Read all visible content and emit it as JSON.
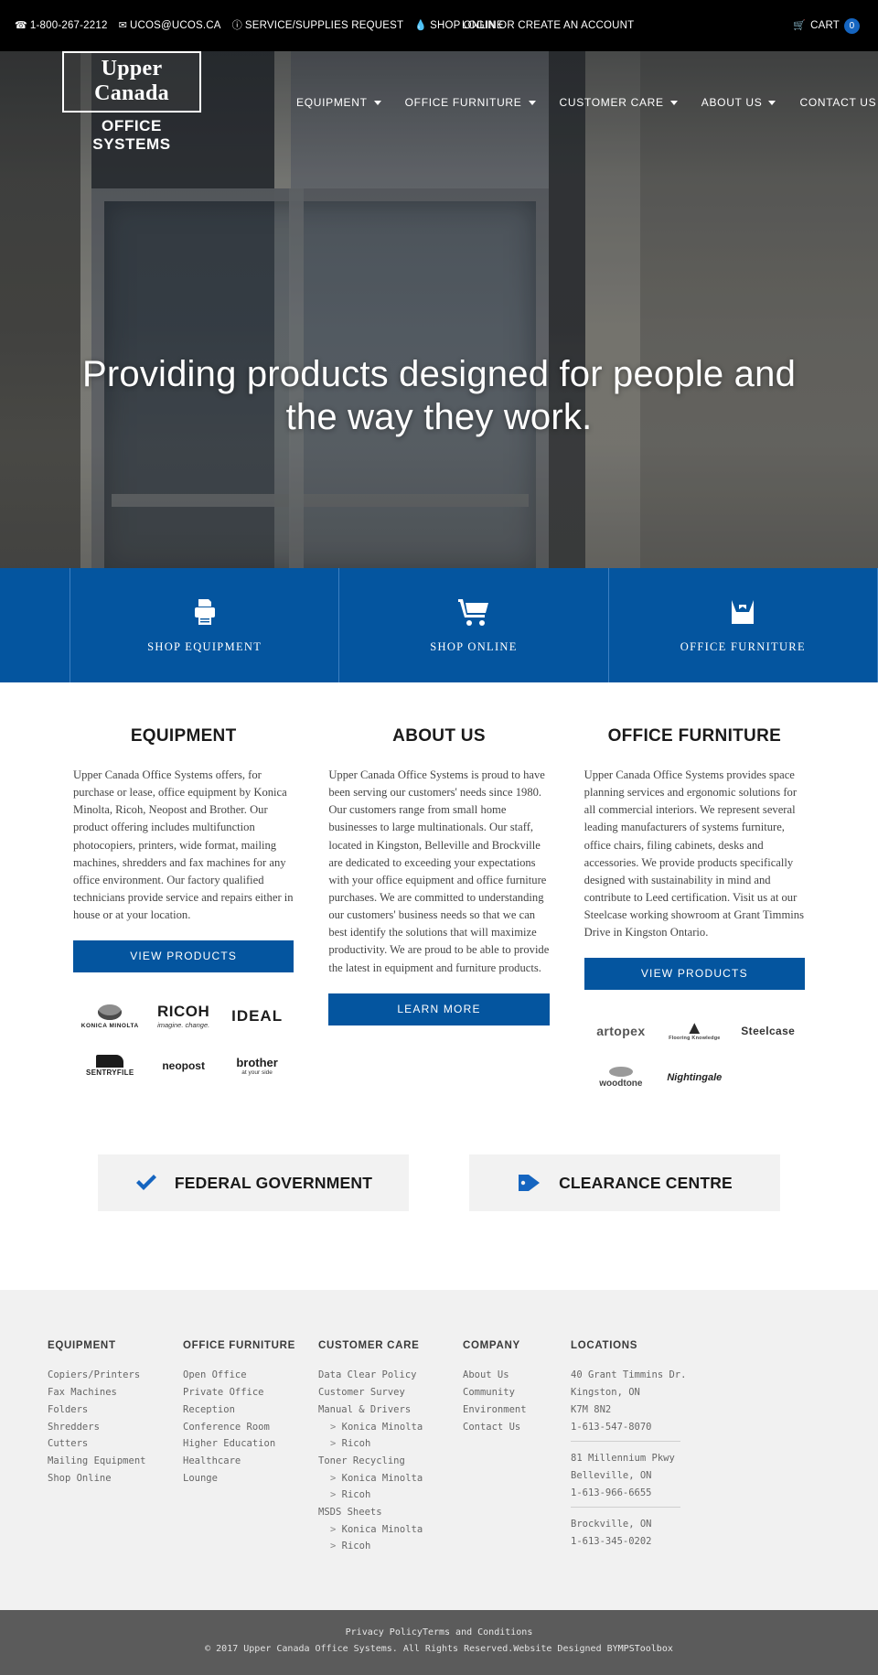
{
  "topbar": {
    "phone": "1-800-267-2212",
    "email": "UCOS@UCOS.CA",
    "service_request": "SERVICE/SUPPLIES REQUEST",
    "shop_online": "SHOP ONLINE",
    "account": "LOGIN OR CREATE AN ACCOUNT",
    "cart_label": "CART",
    "cart_count": "0",
    "cart_badge_color": "#1565c0"
  },
  "header": {
    "logo_top": "Upper Canada",
    "logo_bottom": "OFFICE SYSTEMS",
    "nav": [
      {
        "label": "EQUIPMENT",
        "has_caret": true
      },
      {
        "label": "OFFICE FURNITURE",
        "has_caret": true
      },
      {
        "label": "CUSTOMER CARE",
        "has_caret": true
      },
      {
        "label": "ABOUT US",
        "has_caret": true
      },
      {
        "label": "CONTACT US",
        "has_caret": false
      }
    ]
  },
  "hero": {
    "headline": "Providing products designed for people and the way they work."
  },
  "quickbar": {
    "accent": "#04559f",
    "items": [
      {
        "label": "SHOP EQUIPMENT",
        "icon": "printer-icon"
      },
      {
        "label": "SHOP ONLINE",
        "icon": "cart-icon"
      },
      {
        "label": "OFFICE FURNITURE",
        "icon": "inbox-icon"
      }
    ]
  },
  "columns": [
    {
      "title": "EQUIPMENT",
      "body": "Upper Canada Office Systems offers, for purchase or lease, office equipment by Konica Minolta, Ricoh, Neopost and Brother. Our product offering includes multifunction photocopiers, printers, wide format, mailing machines, shredders and fax machines for any office environment. Our factory qualified technicians provide service and repairs either in house or at your location.",
      "button": "VIEW PRODUCTS",
      "brands": [
        {
          "name": "KONICA MINOLTA",
          "style": "konica"
        },
        {
          "name": "RICOH",
          "tagline": "imagine. change.",
          "style": "ricoh"
        },
        {
          "name": "IDEAL",
          "style": "ideal"
        },
        {
          "name": "SENTRYFILE",
          "style": "sentry"
        },
        {
          "name": "neopost",
          "style": "neopost"
        },
        {
          "name": "brother",
          "tagline": "at your side",
          "style": "brother"
        }
      ]
    },
    {
      "title": "ABOUT US",
      "body": "Upper Canada Office Systems is proud to have been serving our customers' needs since 1980. Our customers range from small home businesses to large multinationals. Our staff, located in Kingston, Belleville and Brockville are dedicated to exceeding your expectations with your office equipment and office furniture purchases. We are committed to understanding our customers' business needs so that we can best identify the solutions that will maximize productivity. We are proud to be able to provide the latest in equipment and furniture products.",
      "button": "LEARN MORE",
      "brands": []
    },
    {
      "title": "OFFICE FURNITURE",
      "body": "Upper Canada Office Systems provides space planning services and ergonomic solutions for all commercial interiors. We represent several leading manufacturers of systems furniture, office chairs, filing cabinets, desks and accessories. We provide products specifically designed with sustainability in mind and contribute to Leed certification. Visit us at our Steelcase working showroom at Grant Timmins Drive in Kingston Ontario.",
      "button": "VIEW PRODUCTS",
      "brands": [
        {
          "name": "artopex",
          "style": "artopex"
        },
        {
          "name": "Flooring Knowledge",
          "style": "kn"
        },
        {
          "name": "Steelcase",
          "style": "steelcase"
        },
        {
          "name": "woodtone",
          "style": "woodtone"
        },
        {
          "name": "Nightingale",
          "style": "nightingale"
        }
      ]
    }
  ],
  "promos": [
    {
      "label": "FEDERAL GOVERNMENT",
      "icon": "check-icon",
      "color": "#1565c0"
    },
    {
      "label": "CLEARANCE CENTRE",
      "icon": "tags-icon",
      "color": "#1565c0"
    }
  ],
  "footer": {
    "columns": [
      {
        "title": "EQUIPMENT",
        "links": [
          {
            "text": "Copiers/Printers",
            "sub": false
          },
          {
            "text": "Fax Machines",
            "sub": false
          },
          {
            "text": "Folders",
            "sub": false
          },
          {
            "text": "Shredders",
            "sub": false
          },
          {
            "text": "Cutters",
            "sub": false
          },
          {
            "text": "Mailing Equipment",
            "sub": false
          },
          {
            "text": "Shop Online",
            "sub": false
          }
        ]
      },
      {
        "title": "OFFICE FURNITURE",
        "links": [
          {
            "text": "Open Office",
            "sub": false
          },
          {
            "text": "Private Office",
            "sub": false
          },
          {
            "text": "Reception",
            "sub": false
          },
          {
            "text": "Conference Room",
            "sub": false
          },
          {
            "text": "Higher Education",
            "sub": false
          },
          {
            "text": "Healthcare",
            "sub": false
          },
          {
            "text": "Lounge",
            "sub": false
          }
        ]
      },
      {
        "title": "CUSTOMER CARE",
        "links": [
          {
            "text": "Data Clear Policy",
            "sub": false
          },
          {
            "text": "Customer Survey",
            "sub": false
          },
          {
            "text": "Manual & Drivers",
            "sub": false
          },
          {
            "text": "Konica Minolta",
            "sub": true
          },
          {
            "text": "Ricoh",
            "sub": true
          },
          {
            "text": "Toner Recycling",
            "sub": false
          },
          {
            "text": "Konica Minolta",
            "sub": true
          },
          {
            "text": "Ricoh",
            "sub": true
          },
          {
            "text": "MSDS Sheets",
            "sub": false
          },
          {
            "text": "Konica Minolta",
            "sub": true
          },
          {
            "text": "Ricoh",
            "sub": true
          }
        ]
      },
      {
        "title": "COMPANY",
        "links": [
          {
            "text": "About Us",
            "sub": false
          },
          {
            "text": "Community",
            "sub": false
          },
          {
            "text": "Environment",
            "sub": false
          },
          {
            "text": "Contact Us",
            "sub": false
          }
        ]
      }
    ],
    "locations": {
      "title": "LOCATIONS",
      "addresses": [
        {
          "lines": [
            "40 Grant Timmins Dr.",
            "Kingston, ON",
            "K7M 8N2",
            "1-613-547-8070"
          ]
        },
        {
          "lines": [
            "81 Millennium Pkwy",
            "Belleville, ON",
            "1-613-966-6655"
          ]
        },
        {
          "lines": [
            "Brockville, ON",
            "1-613-345-0202"
          ]
        }
      ]
    }
  },
  "copyright": {
    "privacy": "Privacy Policy",
    "terms": "Terms and Conditions",
    "line2_pre": "© 2017 Upper Canada Office Systems. All Rights Reserved.",
    "line2_mid": "Website Designed BY",
    "line2_link": "MPSToolbox"
  }
}
